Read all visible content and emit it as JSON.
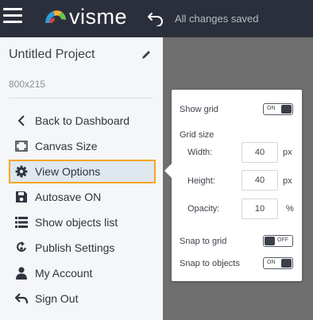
{
  "topbar": {
    "logo_text": "visme",
    "status": "All changes saved"
  },
  "sidebar": {
    "project_title": "Untitled Project",
    "project_size": "800x215",
    "items": [
      {
        "label": "Back to Dashboard",
        "icon": "chevron-left-icon"
      },
      {
        "label": "Canvas Size",
        "icon": "canvas-size-icon"
      },
      {
        "label": "View Options",
        "icon": "gear-icon",
        "active": true
      },
      {
        "label": "Autosave ON",
        "icon": "save-icon"
      },
      {
        "label": "Show objects list",
        "icon": "list-icon"
      },
      {
        "label": "Publish Settings",
        "icon": "publish-icon"
      },
      {
        "label": "My Account",
        "icon": "user-icon"
      },
      {
        "label": "Sign Out",
        "icon": "sign-out-icon"
      }
    ]
  },
  "view_options": {
    "show_grid_label": "Show grid",
    "show_grid_state": "ON",
    "grid_size_label": "Grid size",
    "width_label": "Width:",
    "width_value": "40",
    "width_unit": "px",
    "height_label": "Height:",
    "height_value": "40",
    "height_unit": "px",
    "opacity_label": "Opacity:",
    "opacity_value": "10",
    "opacity_unit": "%",
    "snap_grid_label": "Snap to grid",
    "snap_grid_state": "OFF",
    "snap_objects_label": "Snap to objects",
    "snap_objects_state": "ON"
  },
  "colors": {
    "topbar_bg": "#2a2f3b",
    "canvas_bg": "#6f6f6f",
    "sidebar_bg": "#f4f6f8",
    "highlight": "#f5a623",
    "logo_colors": [
      "#2e9bd6",
      "#f2b134",
      "#6cc24a",
      "#e0413b"
    ]
  }
}
